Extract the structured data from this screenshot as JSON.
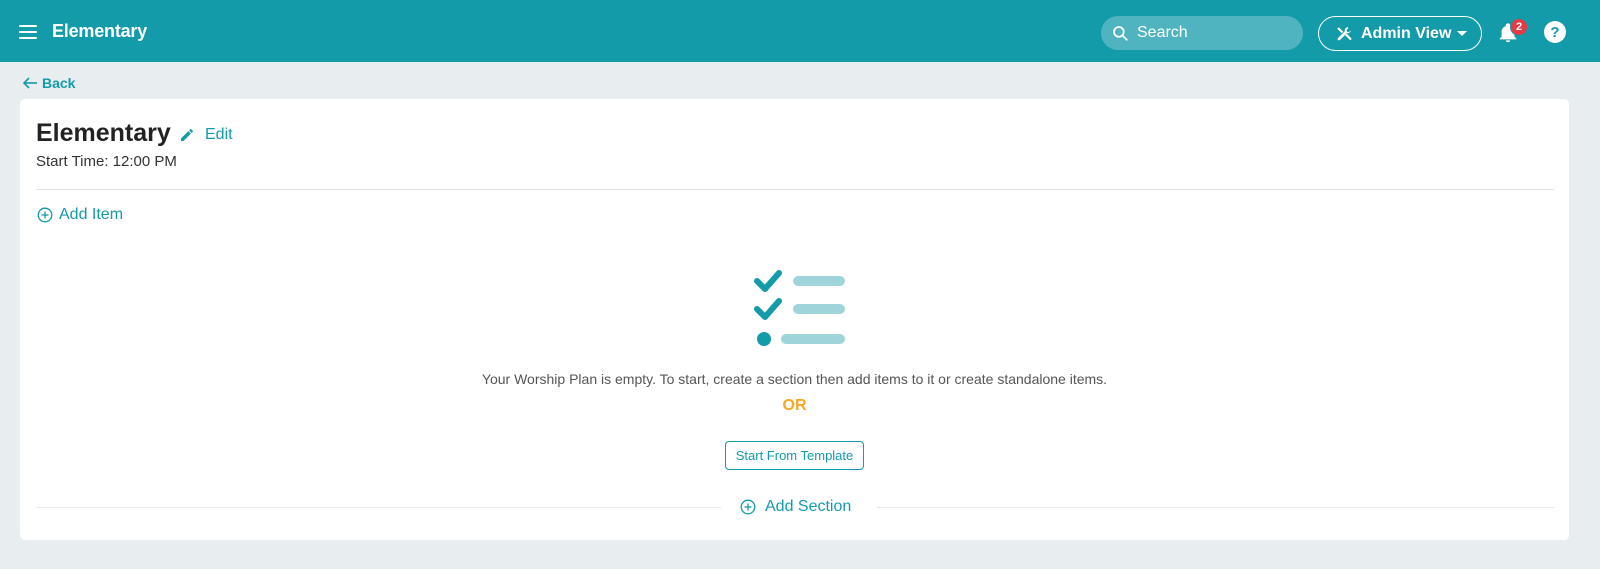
{
  "header": {
    "menu_icon": "hamburger-icon",
    "app_title": "Elementary",
    "search_placeholder": "Search",
    "admin_view_label": "Admin View",
    "notification_count": "2",
    "help_label": "?"
  },
  "nav": {
    "back_label": "Back"
  },
  "plan": {
    "title": "Elementary",
    "edit_label": "Edit",
    "start_time": "Start Time: 12:00 PM",
    "add_item_label": "Add Item",
    "empty_message": "Your Worship Plan is empty. To start, create a section then add items to it or create standalone items.",
    "or_label": "OR",
    "template_button_label": "Start From Template",
    "add_section_label": "Add Section"
  },
  "colors": {
    "brand": "#149baa",
    "accent_or": "#f5a623",
    "badge": "#e53945",
    "background": "#e8eef0"
  }
}
